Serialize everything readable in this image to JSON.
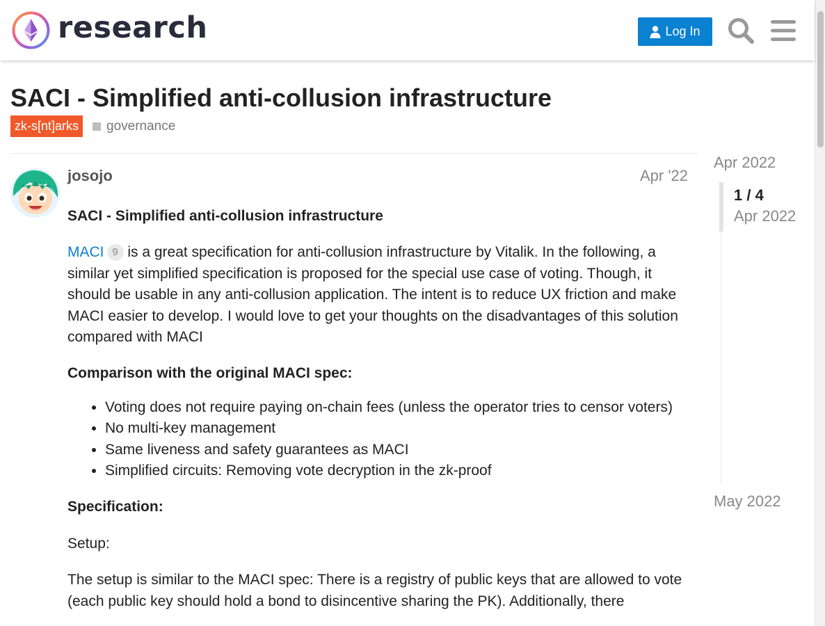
{
  "header": {
    "logo_text": "research",
    "login_label": "Log In",
    "icons": {
      "login": "user-icon",
      "search": "search-icon",
      "menu": "hamburger-menu-icon"
    },
    "accent_color": "#0a81d1"
  },
  "topic": {
    "title": "SACI - Simplified anti-collusion infrastructure",
    "tags": [
      {
        "label": "zk-s[nt]arks",
        "color": "#f1592a"
      },
      {
        "label": "governance",
        "color": "#bdbdbd"
      }
    ]
  },
  "post": {
    "username": "josojo",
    "date": "Apr '22",
    "heading": "SACI - Simplified anti-collusion infrastructure",
    "intro_link": "MACI",
    "intro_link_count": "9",
    "intro_text": " is a great specification for anti-collusion infrastructure by Vitalik. In the following, a similar yet simplified specification is proposed for the special use case of voting. Though, it should be usable in any anti-collusion application. The intent is to reduce UX friction and make MACI easier to develop. I would love to get your thoughts on the disadvantages of this solution compared with MACI",
    "comparison_heading": "Comparison with the original MACI spec:",
    "comparison_items": [
      "Voting does not require paying on-chain fees (unless the operator tries to censor voters)",
      "No multi-key management",
      "Same liveness and safety guarantees as MACI",
      "Simplified circuits: Removing vote decryption in the zk-proof"
    ],
    "spec_heading": "Specification:",
    "setup_label": "Setup:",
    "setup_text": "The setup is similar to the MACI spec: There is a registry of public keys that are allowed to vote (each public key should hold a bond to disincentive sharing the PK). Additionally, there"
  },
  "timeline": {
    "start_label": "Apr 2022",
    "position": "1 / 4",
    "current_date": "Apr 2022",
    "end_label": "May 2022"
  }
}
